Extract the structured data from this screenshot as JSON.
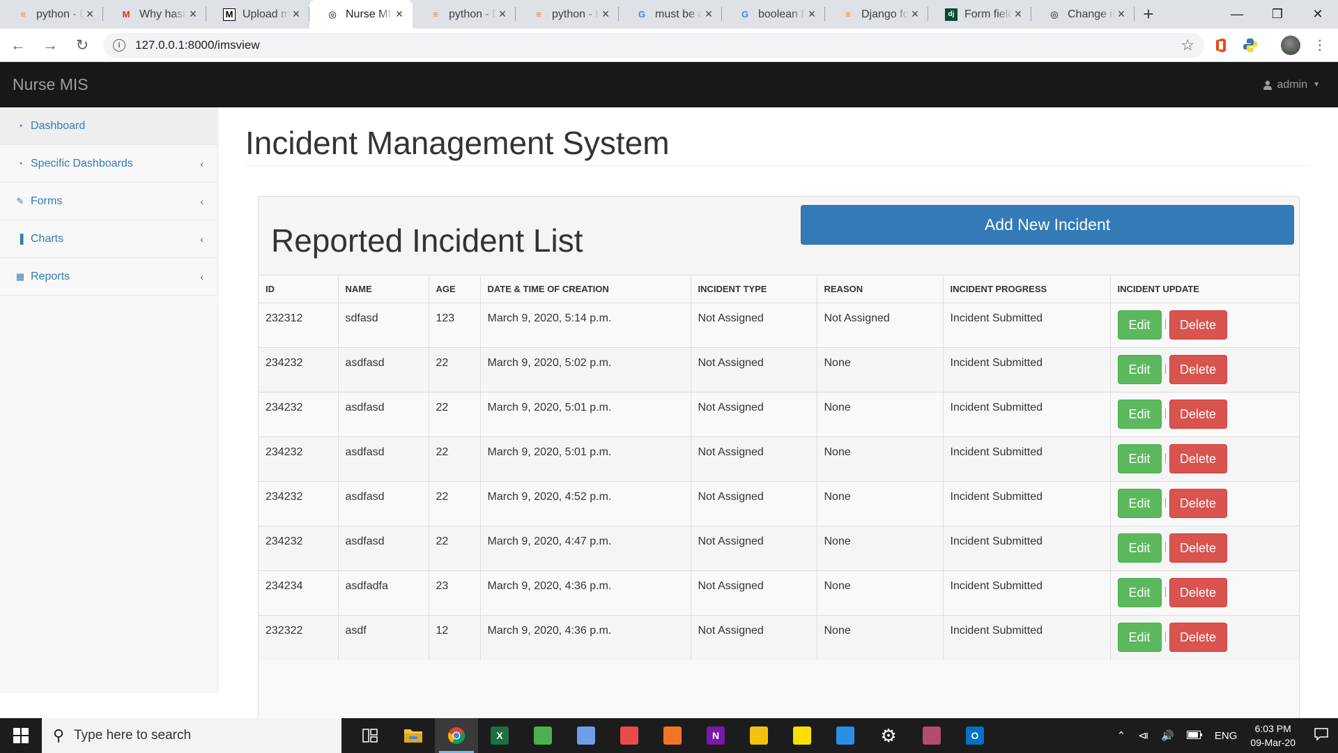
{
  "browser": {
    "tabs": [
      {
        "title": "python - Django",
        "favicon": "stackoverflow-icon",
        "active": false
      },
      {
        "title": "Why hasn't",
        "favicon": "gmail-icon",
        "active": false
      },
      {
        "title": "Upload multiple",
        "favicon": "medium-icon",
        "active": false
      },
      {
        "title": "Nurse MIS",
        "favicon": "globe-icon",
        "active": true
      },
      {
        "title": "python - Django",
        "favicon": "stackoverflow-icon",
        "active": false
      },
      {
        "title": "python - How",
        "favicon": "stackoverflow-icon",
        "active": false
      },
      {
        "title": "must be a",
        "favicon": "google-icon",
        "active": false
      },
      {
        "title": "boolean field",
        "favicon": "google-icon",
        "active": false
      },
      {
        "title": "Django form",
        "favicon": "stackoverflow-icon",
        "active": false
      },
      {
        "title": "Form fields",
        "favicon": "django-icon",
        "active": false
      },
      {
        "title": "Change in",
        "favicon": "globe-icon",
        "active": false
      }
    ],
    "url": "127.0.0.1:8000/imsview"
  },
  "app": {
    "brand": "Nurse MIS",
    "user": "admin"
  },
  "sidebar": {
    "items": [
      {
        "label": "Dashboard",
        "icon": "dashboard-icon",
        "has_submenu": false,
        "active": true
      },
      {
        "label": "Specific Dashboards",
        "icon": "dashboard-icon",
        "has_submenu": true,
        "active": false
      },
      {
        "label": "Forms",
        "icon": "edit-icon",
        "has_submenu": true,
        "active": false
      },
      {
        "label": "Charts",
        "icon": "bar-chart-icon",
        "has_submenu": true,
        "active": false
      },
      {
        "label": "Reports",
        "icon": "table-icon",
        "has_submenu": true,
        "active": false
      }
    ]
  },
  "main": {
    "page_title": "Incident Management System",
    "list_title": "Reported Incident List",
    "add_button": "Add New Incident",
    "columns": [
      "ID",
      "NAME",
      "AGE",
      "DATE & TIME OF CREATION",
      "INCIDENT TYPE",
      "REASON",
      "INCIDENT PROGRESS",
      "INCIDENT UPDATE"
    ],
    "edit_label": "Edit",
    "delete_label": "Delete",
    "rows": [
      {
        "id": "232312",
        "name": "sdfasd",
        "age": "123",
        "created": "March 9, 2020, 5:14 p.m.",
        "type": "Not Assigned",
        "reason": "Not Assigned",
        "progress": "Incident Submitted"
      },
      {
        "id": "234232",
        "name": "asdfasd",
        "age": "22",
        "created": "March 9, 2020, 5:02 p.m.",
        "type": "Not Assigned",
        "reason": "None",
        "progress": "Incident Submitted"
      },
      {
        "id": "234232",
        "name": "asdfasd",
        "age": "22",
        "created": "March 9, 2020, 5:01 p.m.",
        "type": "Not Assigned",
        "reason": "None",
        "progress": "Incident Submitted"
      },
      {
        "id": "234232",
        "name": "asdfasd",
        "age": "22",
        "created": "March 9, 2020, 5:01 p.m.",
        "type": "Not Assigned",
        "reason": "None",
        "progress": "Incident Submitted"
      },
      {
        "id": "234232",
        "name": "asdfasd",
        "age": "22",
        "created": "March 9, 2020, 4:52 p.m.",
        "type": "Not Assigned",
        "reason": "None",
        "progress": "Incident Submitted"
      },
      {
        "id": "234232",
        "name": "asdfasd",
        "age": "22",
        "created": "March 9, 2020, 4:47 p.m.",
        "type": "Not Assigned",
        "reason": "None",
        "progress": "Incident Submitted"
      },
      {
        "id": "234234",
        "name": "asdfadfa",
        "age": "23",
        "created": "March 9, 2020, 4:36 p.m.",
        "type": "Not Assigned",
        "reason": "None",
        "progress": "Incident Submitted"
      },
      {
        "id": "232322",
        "name": "asdf",
        "age": "12",
        "created": "March 9, 2020, 4:36 p.m.",
        "type": "Not Assigned",
        "reason": "None",
        "progress": "Incident Submitted"
      }
    ]
  },
  "taskbar": {
    "search_placeholder": "Type here to search",
    "apps": [
      {
        "name": "task-view-icon",
        "color": "#ffffff"
      },
      {
        "name": "file-explorer-icon",
        "color": "#f8c537"
      },
      {
        "name": "chrome-icon",
        "color": "#db4437",
        "active": true
      },
      {
        "name": "excel-icon",
        "color": "#1d6f42",
        "letter": "X"
      },
      {
        "name": "charts-app-icon",
        "color": "#4caf50"
      },
      {
        "name": "git-icon",
        "color": "#6f9ee8"
      },
      {
        "name": "network-tool-icon",
        "color": "#e94b4b"
      },
      {
        "name": "jupyter-icon",
        "color": "#f37626"
      },
      {
        "name": "onenote-icon",
        "color": "#7719aa",
        "letter": "N"
      },
      {
        "name": "bulb-icon",
        "color": "#f4c20d"
      },
      {
        "name": "sticky-notes-icon",
        "color": "#fce100"
      },
      {
        "name": "vscode-icon",
        "color": "#2b8fe6"
      },
      {
        "name": "settings-icon",
        "color": "#ffffff"
      },
      {
        "name": "winrar-icon",
        "color": "#b24d6e"
      },
      {
        "name": "outlook-icon",
        "color": "#0072c6",
        "letter": "O"
      }
    ],
    "language": "ENG",
    "time": "6:03 PM",
    "date": "09-Mar-20"
  },
  "colors": {
    "primary": "#337ab7",
    "success": "#5cb85c",
    "danger": "#d9534f",
    "navbar": "#181818"
  }
}
